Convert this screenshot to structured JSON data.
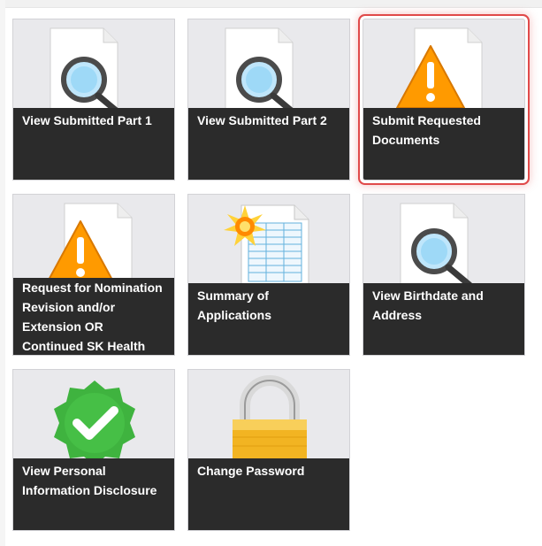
{
  "tiles": [
    {
      "label": "View Submitted Part 1",
      "icon": "magnifier-document-icon"
    },
    {
      "label": "View Submitted Part 2",
      "icon": "magnifier-document-icon"
    },
    {
      "label": "Submit Requested Documents",
      "icon": "warning-document-icon",
      "highlighted": true
    },
    {
      "label": "Request for Nomination Revision and/or Extension OR Continued SK Health",
      "icon": "warning-document-icon"
    },
    {
      "label": "Summary of Applications",
      "icon": "new-spreadsheet-icon"
    },
    {
      "label": "View Birthdate and Address",
      "icon": "magnifier-document-icon"
    },
    {
      "label": "View Personal Information Disclosure",
      "icon": "green-check-badge-icon"
    },
    {
      "label": "Change Password",
      "icon": "padlock-icon"
    }
  ],
  "colors": {
    "caption_bg": "#2b2b2b",
    "tile_bg": "#e9e9ec",
    "highlight": "#e04a4a"
  }
}
